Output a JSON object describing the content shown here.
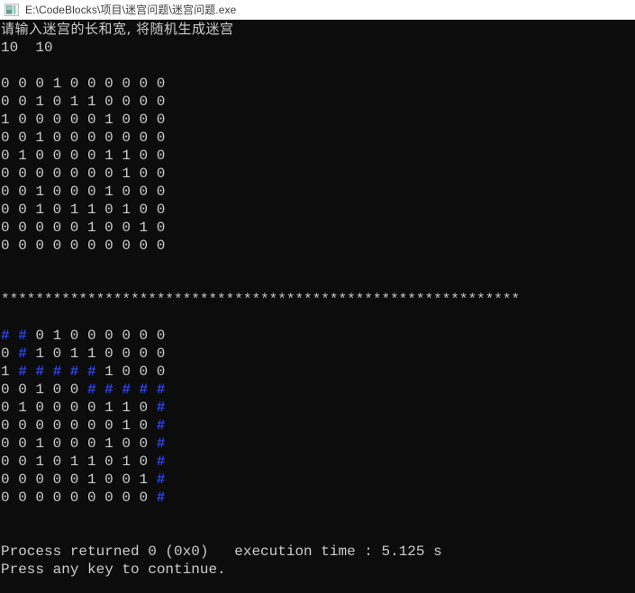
{
  "window": {
    "title": "E:\\CodeBlocks\\项目\\迷宫问题\\迷宫问题.exe",
    "icon": "console-app-icon",
    "titlebar_bg": "#ffffff",
    "titlebar_fg": "#3c3c3c"
  },
  "console": {
    "background": "#0c0c0c",
    "foreground": "#cccccc",
    "path_color": "#2f45e8",
    "prompt": "请输入迷宫的长和宽, 将随机生成迷宫",
    "input_echo": "10  10",
    "separator": "************************************************************",
    "separator_count": 60,
    "maze_size": "10 10",
    "maze_initial": [
      [
        "0",
        "0",
        "0",
        "1",
        "0",
        "0",
        "0",
        "0",
        "0",
        "0"
      ],
      [
        "0",
        "0",
        "1",
        "0",
        "1",
        "1",
        "0",
        "0",
        "0",
        "0"
      ],
      [
        "1",
        "0",
        "0",
        "0",
        "0",
        "0",
        "1",
        "0",
        "0",
        "0"
      ],
      [
        "0",
        "0",
        "1",
        "0",
        "0",
        "0",
        "0",
        "0",
        "0",
        "0"
      ],
      [
        "0",
        "1",
        "0",
        "0",
        "0",
        "0",
        "1",
        "1",
        "0",
        "0"
      ],
      [
        "0",
        "0",
        "0",
        "0",
        "0",
        "0",
        "0",
        "1",
        "0",
        "0"
      ],
      [
        "0",
        "0",
        "1",
        "0",
        "0",
        "0",
        "1",
        "0",
        "0",
        "0"
      ],
      [
        "0",
        "0",
        "1",
        "0",
        "1",
        "1",
        "0",
        "1",
        "0",
        "0"
      ],
      [
        "0",
        "0",
        "0",
        "0",
        "0",
        "1",
        "0",
        "0",
        "1",
        "0"
      ],
      [
        "0",
        "0",
        "0",
        "0",
        "0",
        "0",
        "0",
        "0",
        "0",
        "0"
      ]
    ],
    "maze_solved": [
      [
        "#",
        "#",
        "0",
        "1",
        "0",
        "0",
        "0",
        "0",
        "0",
        "0"
      ],
      [
        "0",
        "#",
        "1",
        "0",
        "1",
        "1",
        "0",
        "0",
        "0",
        "0"
      ],
      [
        "1",
        "#",
        "#",
        "#",
        "#",
        "#",
        "1",
        "0",
        "0",
        "0"
      ],
      [
        "0",
        "0",
        "1",
        "0",
        "0",
        "#",
        "#",
        "#",
        "#",
        "#"
      ],
      [
        "0",
        "1",
        "0",
        "0",
        "0",
        "0",
        "1",
        "1",
        "0",
        "#"
      ],
      [
        "0",
        "0",
        "0",
        "0",
        "0",
        "0",
        "0",
        "1",
        "0",
        "#"
      ],
      [
        "0",
        "0",
        "1",
        "0",
        "0",
        "0",
        "1",
        "0",
        "0",
        "#"
      ],
      [
        "0",
        "0",
        "1",
        "0",
        "1",
        "1",
        "0",
        "1",
        "0",
        "#"
      ],
      [
        "0",
        "0",
        "0",
        "0",
        "0",
        "1",
        "0",
        "0",
        "1",
        "#"
      ],
      [
        "0",
        "0",
        "0",
        "0",
        "0",
        "0",
        "0",
        "0",
        "0",
        "#"
      ]
    ],
    "path_marker": "#",
    "exit_line": "Process returned 0 (0x0)   execution time : 5.125 s",
    "continue_line": "Press any key to continue."
  }
}
